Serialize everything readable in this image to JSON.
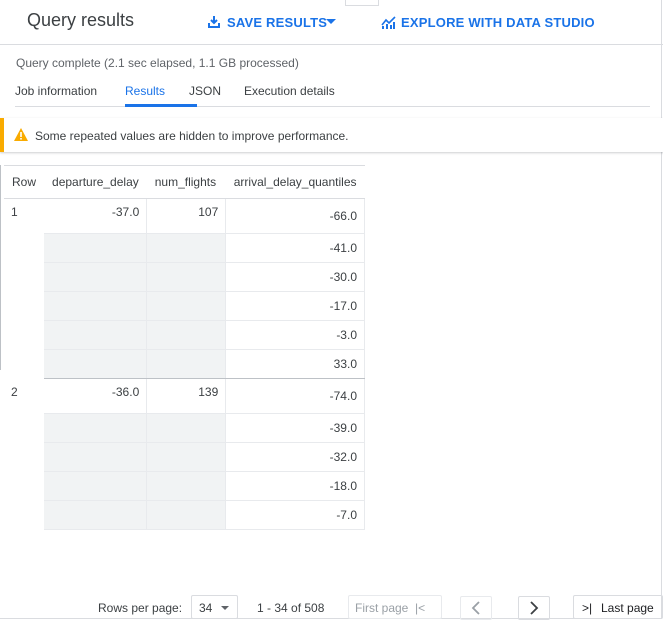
{
  "header": {
    "title": "Query results",
    "save_results_label": "SAVE RESULTS",
    "explore_label": "EXPLORE WITH DATA STUDIO"
  },
  "status": "Query complete (2.1 sec elapsed, 1.1 GB processed)",
  "tabs": [
    {
      "label": "Job information",
      "active": false
    },
    {
      "label": "Results",
      "active": true
    },
    {
      "label": "JSON",
      "active": false
    },
    {
      "label": "Execution details",
      "active": false
    }
  ],
  "warning": {
    "icon": "warning-icon",
    "message": "Some repeated values are hidden to improve performance."
  },
  "table": {
    "headers": [
      "Row",
      "departure_delay",
      "num_flights",
      "arrival_delay_quantiles"
    ],
    "rows": [
      {
        "row": "1",
        "departure_delay": "-37.0",
        "num_flights": "107",
        "arrival_delay_quantiles": [
          "-66.0",
          "-41.0",
          "-30.0",
          "-17.0",
          "-3.0",
          "33.0"
        ]
      },
      {
        "row": "2",
        "departure_delay": "-36.0",
        "num_flights": "139",
        "arrival_delay_quantiles": [
          "-74.0",
          "-39.0",
          "-32.0",
          "-18.0",
          "-7.0"
        ]
      }
    ]
  },
  "pagination": {
    "rows_per_page_label": "Rows per page:",
    "rows_per_page_value": "34",
    "range": "1 - 34 of 508",
    "first_page_label": "First page",
    "first_page_symbol": "|<",
    "last_page_label": "Last page",
    "last_page_symbol": ">|"
  },
  "colors": {
    "accent": "#1a73e8",
    "warning": "#f9ab00",
    "repeated_cell_bg": "#f1f3f4"
  }
}
